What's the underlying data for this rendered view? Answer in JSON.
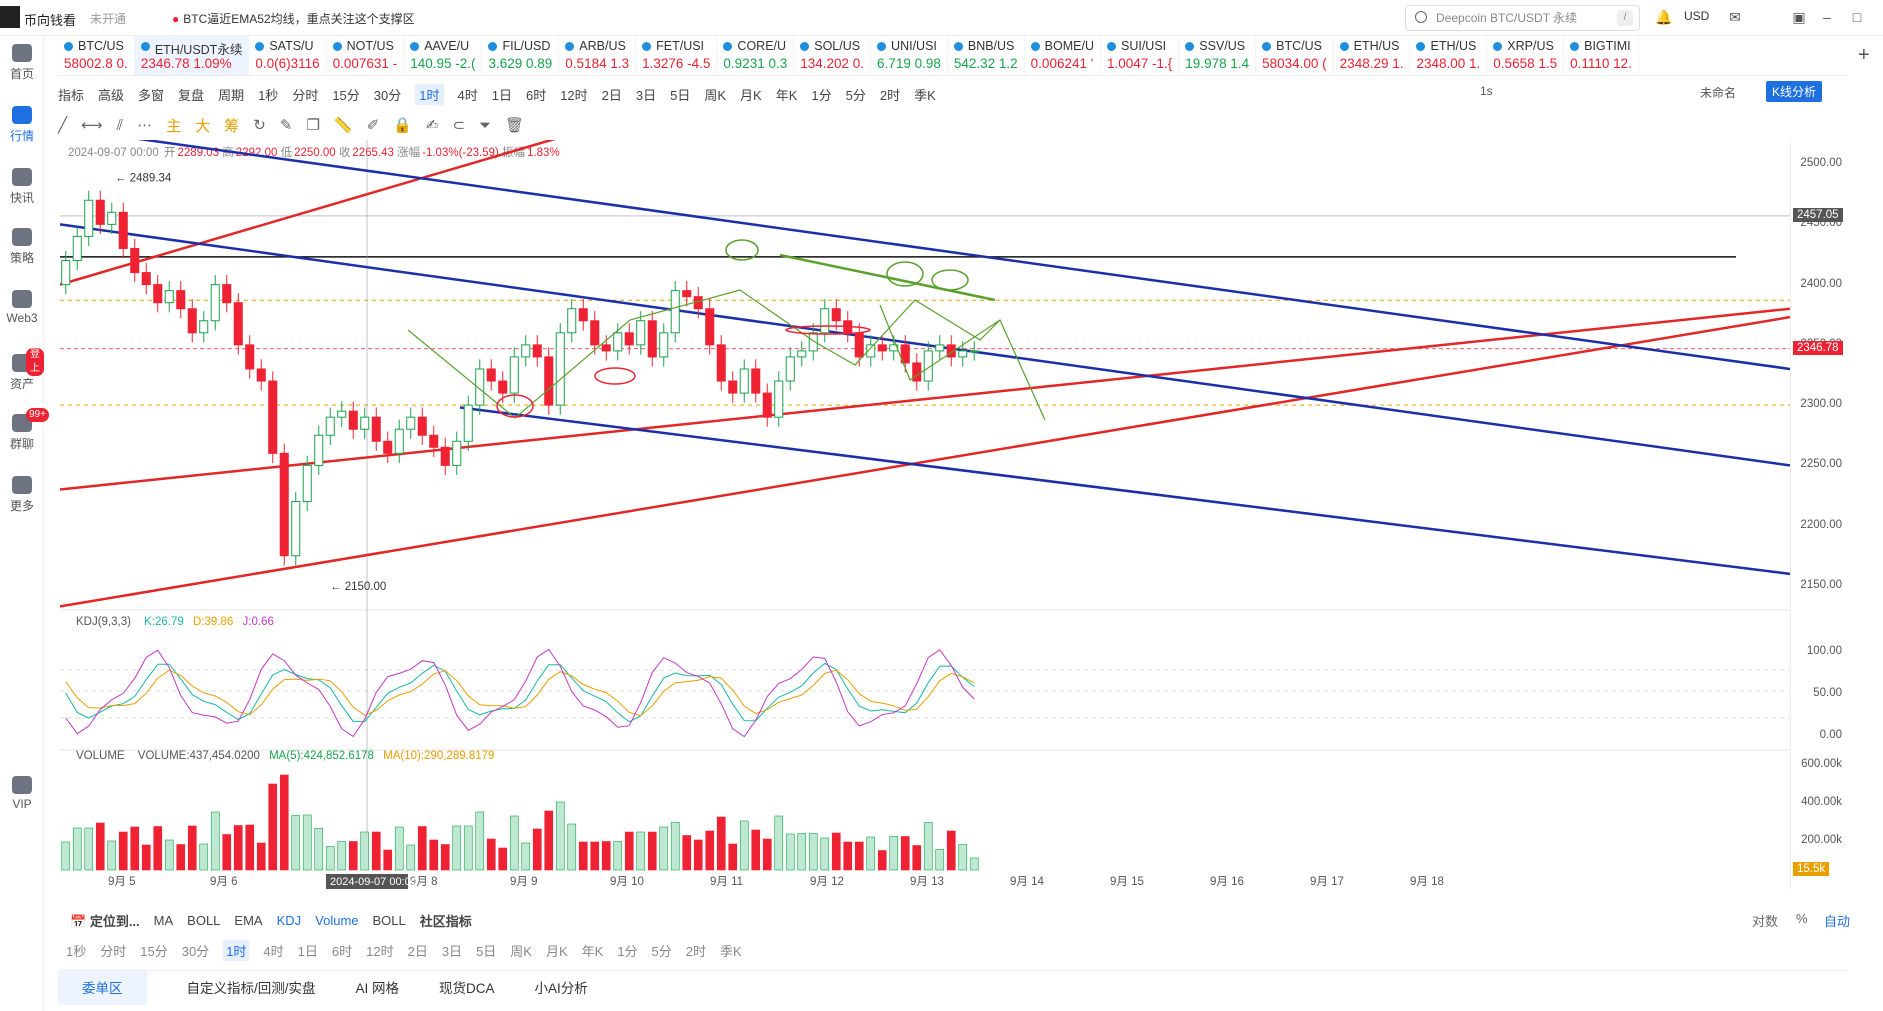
{
  "titlebar": {
    "app_name": "币向钱看",
    "status": "未开通",
    "news": "BTC逼近EMA52均线，重点关注这个支撑区",
    "search_placeholder": "Deepcoin BTC/USDT 永续",
    "search_shortcut": "/",
    "currency": "USD"
  },
  "tickers": [
    {
      "name": "BTC/US",
      "value": "58002.8 0.",
      "up": true,
      "active": false
    },
    {
      "name": "ETH/USDT永续",
      "value": "2346.78 1.09%",
      "up": true,
      "active": true
    },
    {
      "name": "SATS/U",
      "value": "0.0(6)3116",
      "up": true,
      "active": false
    },
    {
      "name": "NOT/US",
      "value": "0.007631 -",
      "up": true,
      "active": false
    },
    {
      "name": "AAVE/U",
      "value": "140.95 -2.(",
      "up": false,
      "active": false
    },
    {
      "name": "FIL/USD",
      "value": "3.629 0.89",
      "up": false,
      "active": false
    },
    {
      "name": "ARB/US",
      "value": "0.5184 1.3",
      "up": true,
      "active": false
    },
    {
      "name": "FET/USI",
      "value": "1.3276 -4.5",
      "up": true,
      "active": false
    },
    {
      "name": "CORE/U",
      "value": "0.9231 0.3",
      "up": false,
      "active": false
    },
    {
      "name": "SOL/US",
      "value": "134.202 0.",
      "up": true,
      "active": false
    },
    {
      "name": "UNI/USI",
      "value": "6.719 0.98",
      "up": false,
      "active": false
    },
    {
      "name": "BNB/US",
      "value": "542.32 1.2",
      "up": false,
      "active": false
    },
    {
      "name": "BOME/U",
      "value": "0.006241 '",
      "up": true,
      "active": false
    },
    {
      "name": "SUI/USI",
      "value": "1.0047 -1.{",
      "up": true,
      "active": false
    },
    {
      "name": "SSV/US",
      "value": "19.978 1.4",
      "up": false,
      "active": false
    },
    {
      "name": "BTC/US",
      "value": "58034.00 (",
      "up": true,
      "active": false
    },
    {
      "name": "ETH/US",
      "value": "2348.29 1.",
      "up": true,
      "active": false
    },
    {
      "name": "ETH/US",
      "value": "2348.00 1.",
      "up": true,
      "active": false
    },
    {
      "name": "XRP/US",
      "value": "0.5658 1.5",
      "up": true,
      "active": false
    },
    {
      "name": "BIGTIMI",
      "value": "0.1110 12.",
      "up": true,
      "active": false
    }
  ],
  "sidebar": [
    {
      "label": "首页",
      "active": false,
      "badge": ""
    },
    {
      "label": "行情",
      "active": true,
      "badge": ""
    },
    {
      "label": "快讯",
      "active": false,
      "badge": ""
    },
    {
      "label": "策略",
      "active": false,
      "badge": ""
    },
    {
      "label": "Web3",
      "active": false,
      "badge": ""
    },
    {
      "label": "资产",
      "active": false,
      "badge": "登上"
    },
    {
      "label": "群聊",
      "active": false,
      "badge": "99+"
    },
    {
      "label": "更多",
      "active": false,
      "badge": ""
    },
    {
      "label": "VIP",
      "active": false,
      "badge": ""
    }
  ],
  "toolbar1": {
    "items": [
      "指标",
      "高级",
      "多窗",
      "复盘",
      "周期",
      "1秒",
      "分时",
      "15分",
      "30分",
      "1时",
      "4时",
      "1日",
      "6时",
      "12时",
      "2日",
      "3日",
      "5日",
      "周K",
      "月K",
      "年K",
      "1分",
      "5分",
      "2时",
      "季K"
    ],
    "active": "1时",
    "right": [
      "1s",
      "未命名"
    ],
    "kline_button": "K线分析"
  },
  "toolbar2": {
    "items": [
      "主",
      "大",
      "筹"
    ]
  },
  "ohlc": {
    "date": "2024-09-07 00:00",
    "open_label": "开",
    "open": "2289.03",
    "high_label": "高",
    "high": "2292.00",
    "low_label": "低",
    "low": "2250.00",
    "close_label": "收",
    "close": "2265.43",
    "change_label": "涨幅",
    "change": "-1.03%(-23.59)",
    "amp_label": "振幅",
    "amp": "1.83%"
  },
  "price_axis": {
    "ticks": [
      "2500.00",
      "2450.00",
      "2400.00",
      "2350.00",
      "2300.00",
      "2250.00",
      "2200.00",
      "2150.00"
    ],
    "crosshair_price": "2457.05",
    "last_price": "2346.78"
  },
  "annotations": {
    "high": "2489.34",
    "low": "2150.00"
  },
  "kdj": {
    "label": "KDJ(9,3,3)",
    "k": "K:26.79",
    "d": "D:39.86",
    "j": "J:0.66",
    "ticks": [
      "100.00",
      "50.00",
      "0.00"
    ]
  },
  "volume": {
    "label": "VOLUME",
    "vol": "VOLUME:437,454.0200",
    "ma5": "MA(5):424,852.6178",
    "ma10": "MA(10):290,289.8179",
    "ticks": [
      "600.00k",
      "400.00k",
      "200.00k"
    ],
    "last": "15.5k"
  },
  "x_axis": {
    "labels": [
      "9月 5",
      "9月 6",
      "9月 8",
      "9月 9",
      "9月 10",
      "9月 11",
      "9月 12",
      "9月 13",
      "9月 14",
      "9月 15",
      "9月 16",
      "9月 17",
      "9月 18"
    ],
    "crosshair": "2024-09-07 00:00"
  },
  "bottom": {
    "locate": "定位到...",
    "indicators_main": [
      "MA",
      "BOLL",
      "EMA"
    ],
    "indicators_sub": [
      "KDJ",
      "Volume",
      "BOLL"
    ],
    "community": "社区指标",
    "right": [
      "对数",
      "%",
      "自动"
    ],
    "periods": [
      "1秒",
      "分时",
      "15分",
      "30分",
      "1时",
      "4时",
      "1日",
      "6时",
      "12时",
      "2日",
      "3日",
      "5日",
      "周K",
      "月K",
      "年K",
      "1分",
      "5分",
      "2时",
      "季K"
    ],
    "active_period": "1时",
    "tabs": [
      "委单区",
      "自定义指标/回测/实盘",
      "AI 网格",
      "现货DCA",
      "小AI分析"
    ]
  },
  "colors": {
    "up": "#18a44c",
    "down": "#e23",
    "accent": "#1e6fe0",
    "red_line": "#e32626",
    "blue_line": "#1a2fa8",
    "green_line": "#5aa02c"
  },
  "chart_data": {
    "type": "candlestick",
    "ylim": [
      2130,
      2520
    ],
    "series": [
      {
        "close": [
          2420,
          2440,
          2470,
          2450,
          2460,
          2430,
          2410,
          2400,
          2385,
          2395,
          2380,
          2360,
          2370,
          2400,
          2385,
          2350,
          2330,
          2320,
          2260,
          2175,
          2220,
          2250,
          2275,
          2290,
          2295,
          2280,
          2290,
          2270,
          2260,
          2280,
          2290,
          2275,
          2265,
          2250,
          2270,
          2300,
          2330,
          2320,
          2310,
          2340,
          2350,
          2340,
          2300,
          2360,
          2380,
          2370,
          2350,
          2345,
          2360,
          2350,
          2370,
          2340,
          2360,
          2395,
          2390,
          2380,
          2350,
          2320,
          2310,
          2330,
          2310,
          2290,
          2320,
          2340,
          2345,
          2360,
          2380,
          2370,
          2360,
          2340,
          2350,
          2345,
          2350,
          2335,
          2320,
          2345,
          2350,
          2340,
          2345,
          2345
        ]
      }
    ],
    "trendlines": "descending and ascending channels"
  }
}
